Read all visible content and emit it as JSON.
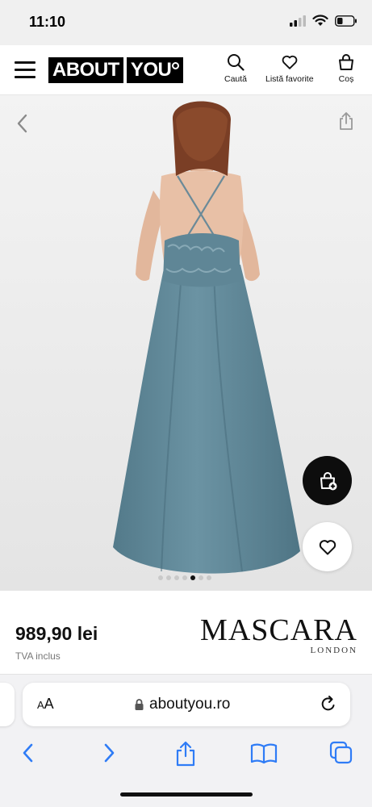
{
  "status_bar": {
    "time": "11:10"
  },
  "header": {
    "logo_part1": "ABOUT",
    "logo_part2": "YOU",
    "actions": {
      "search_label": "Caută",
      "wishlist_label": "Listă favorite",
      "cart_label": "Coș"
    }
  },
  "product": {
    "image_description": "dress-back-view",
    "carousel_total": 7,
    "carousel_active_index": 4
  },
  "price_section": {
    "price": "989,90 lei",
    "vat_note": "TVA inclus",
    "brand_name": "MASCARA",
    "brand_sub": "LONDON"
  },
  "browser": {
    "aa_label_small": "A",
    "aa_label_large": "A",
    "url": "aboutyou.ro"
  },
  "colors": {
    "accent": "#0d0d0d",
    "dress": "#5f8696",
    "backdrop": "#ececec",
    "ios_blue": "#2f7cf6"
  }
}
